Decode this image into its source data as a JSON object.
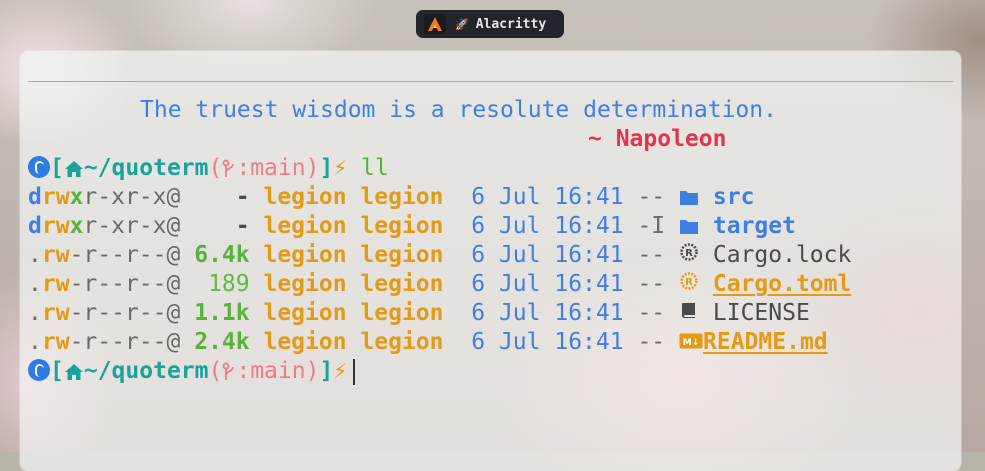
{
  "topbar": {
    "app_title": "Alacritty",
    "rocket_glyph": "🚀"
  },
  "terminal": {
    "quote": "The truest wisdom is a resolute determination.",
    "author": "~ Napoleon",
    "prompt": {
      "open_bracket": "[",
      "path": "~/quoterm",
      "git_open": "(",
      "branch_prefix": ":",
      "branch": "main",
      "git_close": ")",
      "close_bracket": "]",
      "bolt": "⚡",
      "command": "ll"
    },
    "listing": [
      {
        "perm_d": "d",
        "perm_rw": "rw",
        "perm_x": "x",
        "perm_rest": "r-xr-x@",
        "size": "-",
        "user": "legion",
        "group": "legion",
        "day": "6",
        "month": "Jul",
        "time": "16:41",
        "git": "--",
        "icon": "folder-icon",
        "name": "src"
      },
      {
        "perm_d": "d",
        "perm_rw": "rw",
        "perm_x": "x",
        "perm_rest": "r-xr-x@",
        "size": "-",
        "user": "legion",
        "group": "legion",
        "day": "6",
        "month": "Jul",
        "time": "16:41",
        "git": "-I",
        "icon": "folder-icon",
        "name": "target"
      },
      {
        "perm_d": ".",
        "perm_rw": "rw",
        "perm_x": "-",
        "perm_rest": "r--r--@",
        "size": "6.4k",
        "user": "legion",
        "group": "legion",
        "day": "6",
        "month": "Jul",
        "time": "16:41",
        "git": "--",
        "icon": "rust-icon",
        "name": "Cargo.lock"
      },
      {
        "perm_d": ".",
        "perm_rw": "rw",
        "perm_x": "-",
        "perm_rest": "r--r--@",
        "size": "189",
        "user": "legion",
        "group": "legion",
        "day": "6",
        "month": "Jul",
        "time": "16:41",
        "git": "--",
        "icon": "rust-icon",
        "name": "Cargo.toml"
      },
      {
        "perm_d": ".",
        "perm_rw": "rw",
        "perm_x": "-",
        "perm_rest": "r--r--@",
        "size": "1.1k",
        "user": "legion",
        "group": "legion",
        "day": "6",
        "month": "Jul",
        "time": "16:41",
        "git": "--",
        "icon": "book-icon",
        "name": "LICENSE"
      },
      {
        "perm_d": ".",
        "perm_rw": "rw",
        "perm_x": "-",
        "perm_rest": "r--r--@",
        "size": "2.4k",
        "user": "legion",
        "group": "legion",
        "day": "6",
        "month": "Jul",
        "time": "16:41",
        "git": "--",
        "icon": "markdown-icon",
        "name": "README.md"
      }
    ]
  },
  "colors": {
    "accent_blue": "#3f7fe0",
    "prompt_teal": "#1aa39a",
    "git_pink": "#ef7b86",
    "owner_orange": "#e39a17",
    "size_green": "#58b23b",
    "author_red": "#e3344d",
    "rule_orange": "#e3a23c"
  }
}
